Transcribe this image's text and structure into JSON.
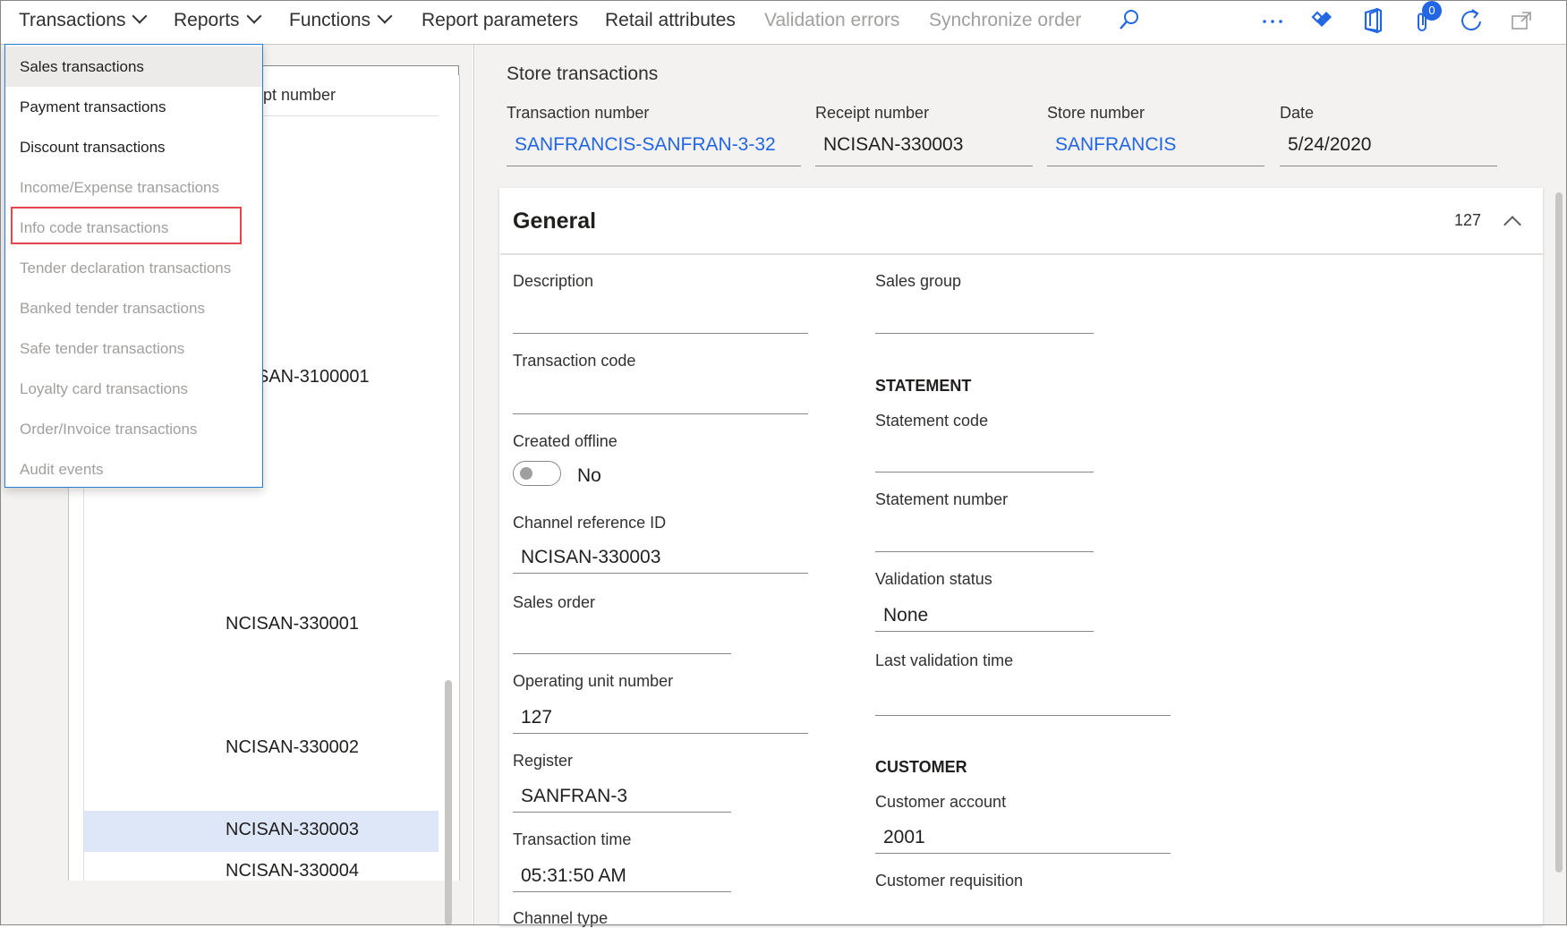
{
  "topbar": {
    "menus": [
      {
        "label": "Transactions",
        "has_chevron": true
      },
      {
        "label": "Reports",
        "has_chevron": true
      },
      {
        "label": "Functions",
        "has_chevron": true
      },
      {
        "label": "Report parameters"
      },
      {
        "label": "Retail attributes"
      },
      {
        "label": "Validation errors",
        "disabled": true
      },
      {
        "label": "Synchronize order",
        "disabled": true
      }
    ],
    "icons": [
      "search-icon",
      "more-icon",
      "power-apps-icon",
      "office-icon",
      "attachments-icon",
      "refresh-icon",
      "open-new-window-icon"
    ],
    "attachment_count": "0"
  },
  "transactions_menu": {
    "items": [
      {
        "label": "Sales transactions",
        "disabled": false
      },
      {
        "label": "Payment transactions",
        "disabled": false
      },
      {
        "label": "Discount transactions",
        "disabled": false
      },
      {
        "label": "Income/Expense transactions",
        "disabled": true
      },
      {
        "label": "Info code transactions",
        "disabled": true
      },
      {
        "label": "Tender declaration transactions",
        "disabled": true
      },
      {
        "label": "Banked tender transactions",
        "disabled": true
      },
      {
        "label": "Safe tender transactions",
        "disabled": true
      },
      {
        "label": "Loyalty card transactions",
        "disabled": true
      },
      {
        "label": "Order/Invoice transactions",
        "disabled": true
      },
      {
        "label": "Audit events",
        "disabled": true
      }
    ]
  },
  "list": {
    "column_header": "ipt number",
    "rows": [
      "SAN-3100001",
      "NCISAN-330001",
      "NCISAN-330002",
      "NCISAN-330003",
      "NCISAN-330004"
    ],
    "selected_index": 3
  },
  "header": {
    "title": "Store transactions",
    "transaction_number_label": "Transaction number",
    "transaction_number": "SANFRANCIS-SANFRAN-3-32",
    "receipt_number_label": "Receipt number",
    "receipt_number": "NCISAN-330003",
    "store_number_label": "Store number",
    "store_number": "SANFRANCIS",
    "date_label": "Date",
    "date": "5/24/2020"
  },
  "general": {
    "title": "General",
    "count": "127",
    "description_label": "Description",
    "description": "",
    "transaction_code_label": "Transaction code",
    "transaction_code": "",
    "created_offline_label": "Created offline",
    "created_offline": "No",
    "channel_reference_label": "Channel reference ID",
    "channel_reference": "NCISAN-330003",
    "sales_order_label": "Sales order",
    "sales_order": "",
    "operating_unit_label": "Operating unit number",
    "operating_unit": "127",
    "register_label": "Register",
    "register": "SANFRAN-3",
    "transaction_time_label": "Transaction time",
    "transaction_time": "05:31:50 AM",
    "channel_type_label": "Channel type",
    "sales_group_label": "Sales group",
    "sales_group": "",
    "statement_section": "STATEMENT",
    "statement_code_label": "Statement code",
    "statement_code": "",
    "statement_number_label": "Statement number",
    "statement_number": "",
    "validation_status_label": "Validation status",
    "validation_status": "None",
    "last_validation_label": "Last validation time",
    "last_validation": "",
    "customer_section": "CUSTOMER",
    "customer_account_label": "Customer account",
    "customer_account": "2001",
    "customer_requisition_label": "Customer requisition"
  },
  "colors": {
    "link": "#2266e3",
    "selected_row": "#dee7f8",
    "highlight_box": "#e3474b",
    "menu_border": "#2b7cd3"
  }
}
